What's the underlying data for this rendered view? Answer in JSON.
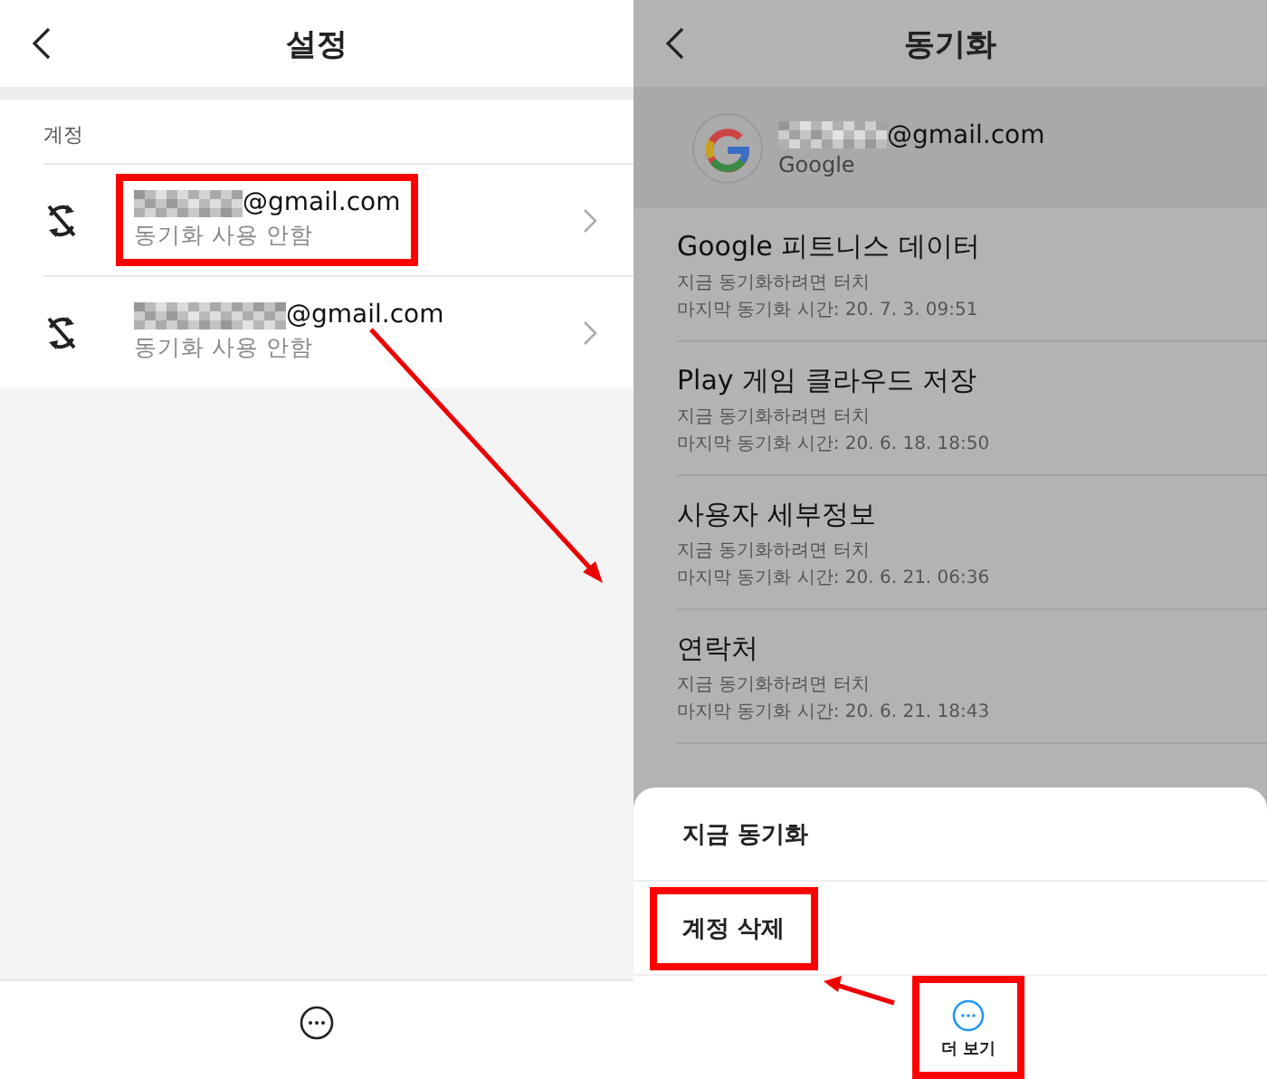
{
  "settings_screen": {
    "title": "설정",
    "section_label": "계정",
    "accounts": [
      {
        "email": "@gmail.com",
        "status": "동기화 사용 안함",
        "sync_on": false,
        "highlighted": true
      },
      {
        "email": "@gmail.com",
        "status": "동기화 사용 안함",
        "sync_on": false,
        "highlighted": false
      }
    ]
  },
  "sync_screen": {
    "title": "동기화",
    "account": {
      "email": "@gmail.com",
      "provider": "Google"
    },
    "items": [
      {
        "name": "Google 피트니스 데이터",
        "hint": "지금 동기화하려면 터치",
        "last_sync": "마지막 동기화 시간: 20. 7. 3. 09:51"
      },
      {
        "name": "Play 게임 클라우드 저장",
        "hint": "지금 동기화하려면 터치",
        "last_sync": "마지막 동기화 시간: 20. 6. 18. 18:50"
      },
      {
        "name": "사용자 세부정보",
        "hint": "지금 동기화하려면 터치",
        "last_sync": "마지막 동기화 시간: 20. 6. 21. 06:36"
      },
      {
        "name": "연락처",
        "hint": "지금 동기화하려면 터치",
        "last_sync": "마지막 동기화 시간: 20. 6. 21. 18:43"
      }
    ],
    "sheet": {
      "actions": [
        {
          "label": "지금 동기화",
          "highlighted": false
        },
        {
          "label": "계정 삭제",
          "highlighted": true
        }
      ],
      "more_button": {
        "label": "더 보기",
        "highlighted": true
      }
    }
  }
}
